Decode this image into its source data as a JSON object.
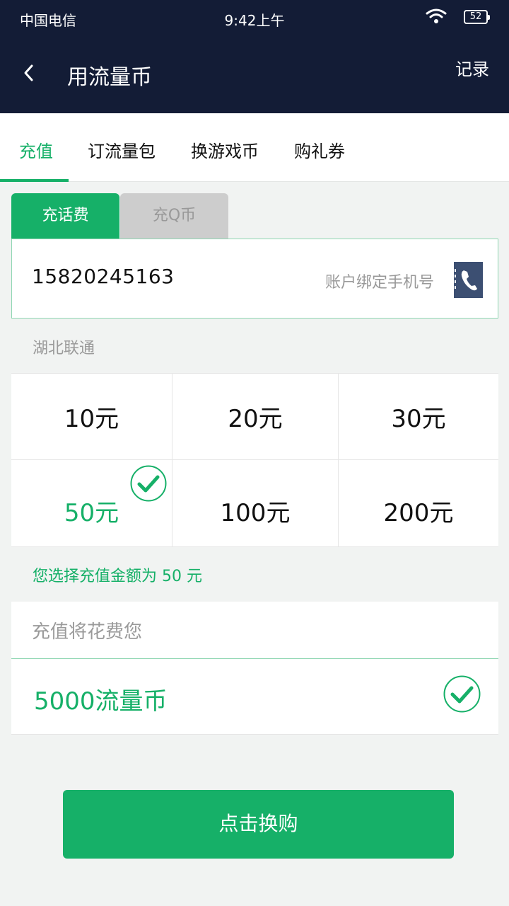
{
  "status_bar": {
    "carrier": "中国电信",
    "time": "9:42上午",
    "battery": "52"
  },
  "app_bar": {
    "title": "用流量币",
    "records_label": "记录"
  },
  "tabs": [
    {
      "label": "充值",
      "active": true
    },
    {
      "label": "订流量包",
      "active": false
    },
    {
      "label": "换游戏币",
      "active": false
    },
    {
      "label": "购礼券",
      "active": false
    }
  ],
  "sub_tabs": [
    {
      "label": "充话费",
      "active": true
    },
    {
      "label": "充Q币",
      "active": false
    }
  ],
  "phone_input": {
    "value": "15820245163",
    "hint": "账户绑定手机号"
  },
  "carrier_info": "湖北联通",
  "amounts": [
    {
      "label": "10元",
      "selected": false
    },
    {
      "label": "20元",
      "selected": false
    },
    {
      "label": "30元",
      "selected": false
    },
    {
      "label": "50元",
      "selected": true
    },
    {
      "label": "100元",
      "selected": false
    },
    {
      "label": "200元",
      "selected": false
    }
  ],
  "selection_summary": "您选择充值金额为 50 元",
  "cost": {
    "label": "充值将花费您",
    "amount": "5000流量币"
  },
  "buy_button": "点击换购",
  "colors": {
    "accent": "#16b068",
    "header_bg": "#131c36"
  }
}
